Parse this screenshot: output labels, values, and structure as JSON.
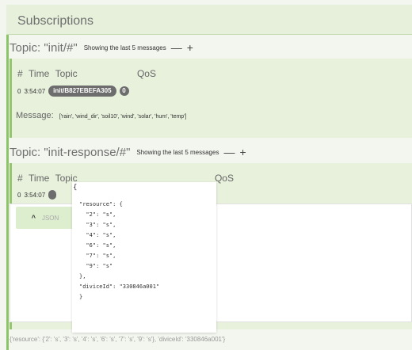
{
  "header": {
    "title": "Subscriptions"
  },
  "topic1": {
    "label": "Topic: \"init/#\"",
    "note": "Showing the last 5 messages",
    "minus": "—",
    "plus": "+"
  },
  "table1": {
    "col_hash": "#",
    "col_time": "Time",
    "col_topic": "Topic",
    "col_qos": "QoS"
  },
  "row1": {
    "index": "0",
    "time": "3:54:07",
    "topic": "init/B827EBEFA305",
    "qos": "0"
  },
  "message1": {
    "label": "Message:",
    "body": "['rain', 'wind_dir', 'soil10', 'wind', 'solar', 'hum', 'temp']"
  },
  "topic2": {
    "label": "Topic: \"init-response/#\"",
    "note": "Showing the last 5 messages",
    "minus": "—",
    "plus": "+"
  },
  "table2": {
    "col_hash": "#",
    "col_time": "Time",
    "col_topic": "Topic",
    "col_qos": "QoS"
  },
  "row2": {
    "index": "0",
    "time": "3:54:07"
  },
  "json_button": {
    "label": "JSON",
    "caret": "^"
  },
  "json_popup": {
    "open_brace": "{",
    "code": "\"resource\": {\n  \"2\": \"s\",\n  \"3\": \"s\",\n  \"4\": \"s\",\n  \"6\": \"s\",\n  \"7\": \"s\",\n  \"9\": \"s\"\n},\n\"diviceId\": \"330846a001\"\n}"
  },
  "footer": {
    "text": "{'resource': {'2': 's', '3': 's', '4': 's', '6': 's', '7': 's', '9': 's'}, 'diviceId': '330846a001'}"
  }
}
